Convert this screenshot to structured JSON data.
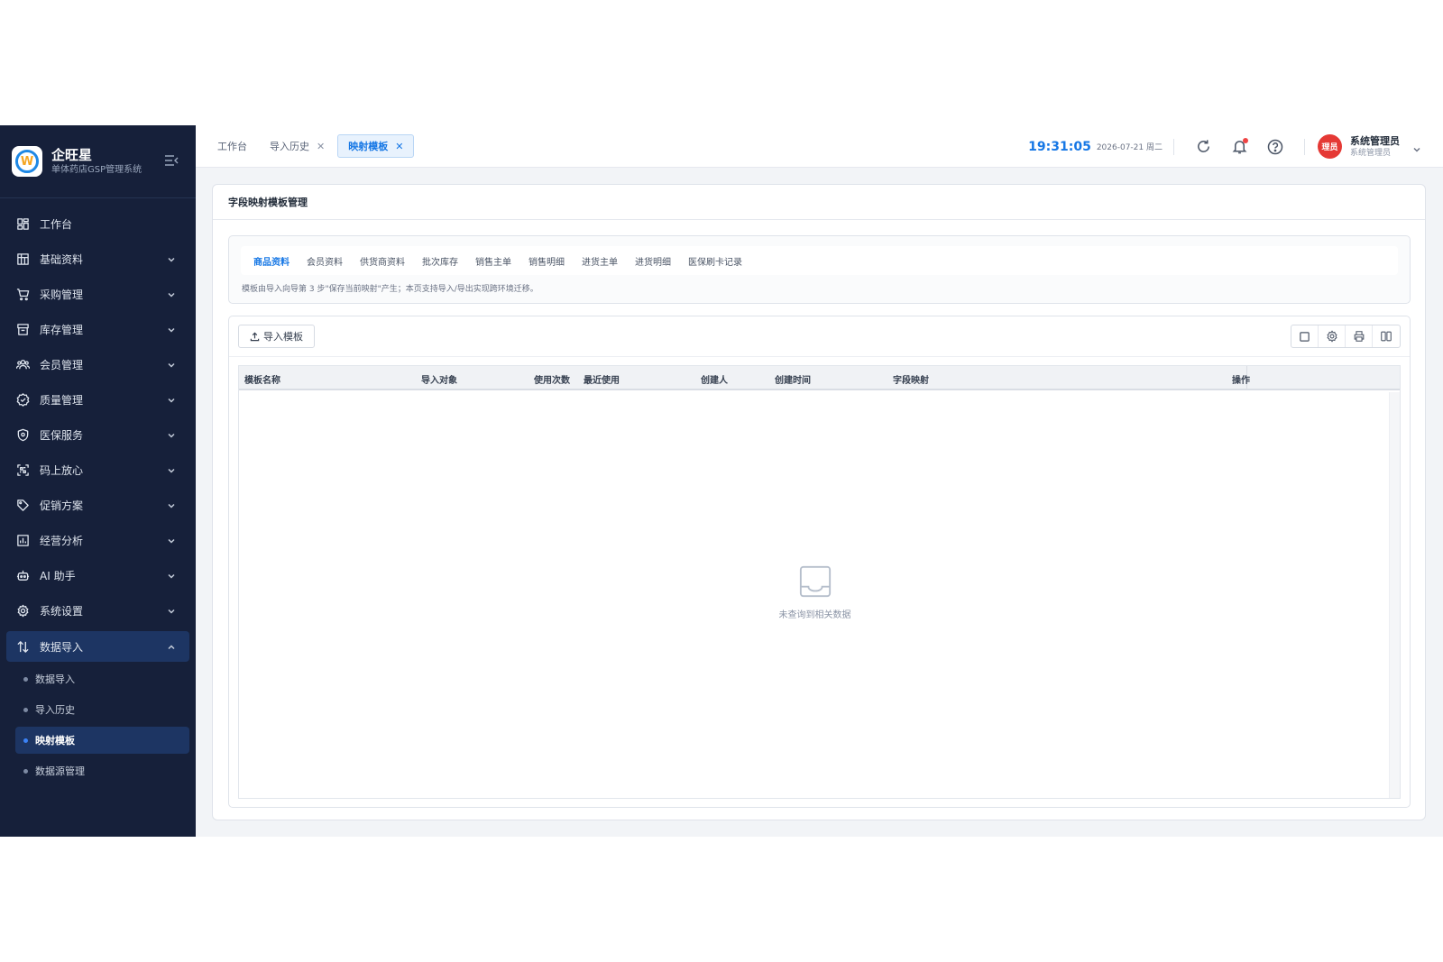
{
  "brand": {
    "title": "企旺星",
    "subtitle": "单体药店GSP管理系统",
    "logo_letter": "W"
  },
  "sidebar": {
    "items": [
      {
        "label": "工作台",
        "icon": "dashboard-icon",
        "expandable": false
      },
      {
        "label": "基础资料",
        "icon": "grid-icon",
        "expandable": true
      },
      {
        "label": "采购管理",
        "icon": "cart-icon",
        "expandable": true
      },
      {
        "label": "库存管理",
        "icon": "archive-icon",
        "expandable": true
      },
      {
        "label": "会员管理",
        "icon": "users-icon",
        "expandable": true
      },
      {
        "label": "质量管理",
        "icon": "badge-check-icon",
        "expandable": true
      },
      {
        "label": "医保服务",
        "icon": "shield-icon",
        "expandable": true
      },
      {
        "label": "码上放心",
        "icon": "scan-icon",
        "expandable": true
      },
      {
        "label": "促销方案",
        "icon": "tag-icon",
        "expandable": true
      },
      {
        "label": "经营分析",
        "icon": "chart-icon",
        "expandable": true
      },
      {
        "label": "AI 助手",
        "icon": "robot-icon",
        "expandable": true
      },
      {
        "label": "系统设置",
        "icon": "gear-icon",
        "expandable": true
      },
      {
        "label": "数据导入",
        "icon": "swap-icon",
        "expandable": true,
        "open": true
      }
    ],
    "subitems": [
      {
        "label": "数据导入",
        "active": false
      },
      {
        "label": "导入历史",
        "active": false
      },
      {
        "label": "映射模板",
        "active": true
      },
      {
        "label": "数据源管理",
        "active": false
      }
    ]
  },
  "tabs": [
    {
      "label": "工作台",
      "closable": false,
      "active": false
    },
    {
      "label": "导入历史",
      "closable": true,
      "active": false
    },
    {
      "label": "映射模板",
      "closable": true,
      "active": true
    }
  ],
  "header": {
    "time": "19:31:05",
    "date": "2026-07-21 周二",
    "user_name": "系统管理员",
    "user_role": "系统管理员",
    "avatar_text": "理员"
  },
  "page": {
    "title": "字段映射模板管理",
    "subtabs": [
      "商品资料",
      "会员资料",
      "供货商资料",
      "批次库存",
      "销售主单",
      "销售明细",
      "进货主单",
      "进货明细",
      "医保刷卡记录"
    ],
    "active_subtab": 0,
    "hint": "模板由导入向导第 3 步\"保存当前映射\"产生；本页支持导入/导出实现跨环境迁移。",
    "import_button": "导入模板",
    "columns": [
      "模板名称",
      "导入对象",
      "使用次数",
      "最近使用",
      "创建人",
      "创建时间",
      "字段映射",
      "操作"
    ],
    "rows": [],
    "empty_text": "未查询到相关数据"
  },
  "colors": {
    "sidebar_bg": "#16203a",
    "accent": "#1677e5",
    "active_bg": "#1d3563",
    "avatar_bg": "#e53935"
  }
}
